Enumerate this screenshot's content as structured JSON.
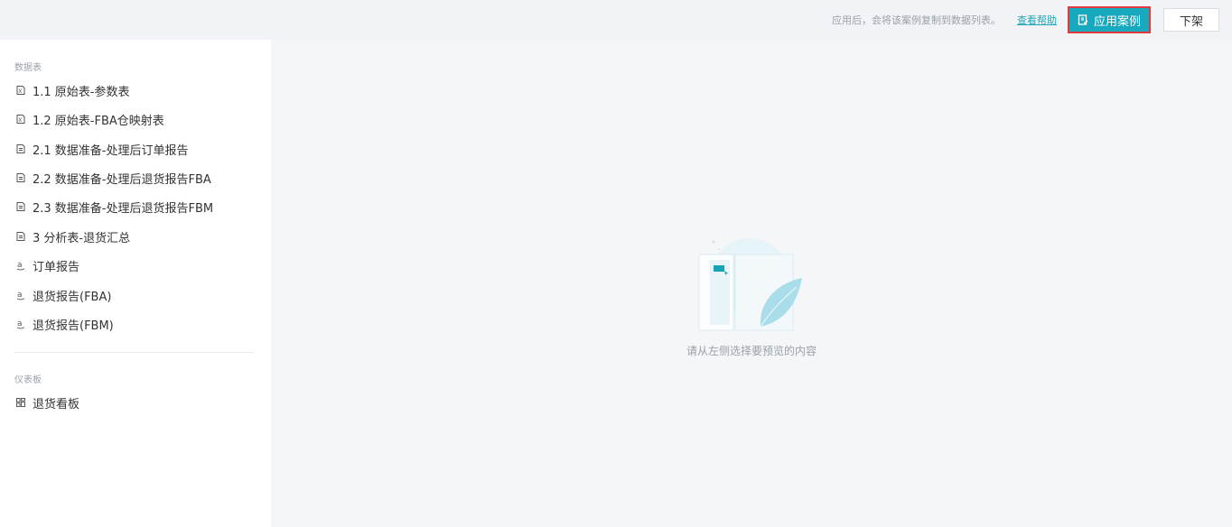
{
  "header": {
    "tip": "应用后，会将该案例复制到数据列表。",
    "help_label": "查看帮助",
    "apply_label": "应用案例",
    "offline_label": "下架"
  },
  "sidebar": {
    "datatable_title": "数据表",
    "datatable_items": [
      {
        "label": "1.1 原始表-参数表",
        "icon": "excel-icon"
      },
      {
        "label": "1.2 原始表-FBA仓映射表",
        "icon": "excel-icon"
      },
      {
        "label": "2.1 数据准备-处理后订单报告",
        "icon": "document-icon"
      },
      {
        "label": "2.2 数据准备-处理后退货报告FBA",
        "icon": "document-icon"
      },
      {
        "label": "2.3 数据准备-处理后退货报告FBM",
        "icon": "document-icon"
      },
      {
        "label": "3 分析表-退货汇总",
        "icon": "document-icon"
      },
      {
        "label": "订单报告",
        "icon": "amazon-icon"
      },
      {
        "label": "退货报告(FBA)",
        "icon": "amazon-icon"
      },
      {
        "label": "退货报告(FBM)",
        "icon": "amazon-icon"
      }
    ],
    "dashboard_title": "仪表板",
    "dashboard_items": [
      {
        "label": "退货看板",
        "icon": "dashboard-icon"
      }
    ]
  },
  "main": {
    "empty_text": "请从左侧选择要预览的内容"
  },
  "colors": {
    "accent": "#17a9bd",
    "highlight_border": "#e03a3a"
  }
}
